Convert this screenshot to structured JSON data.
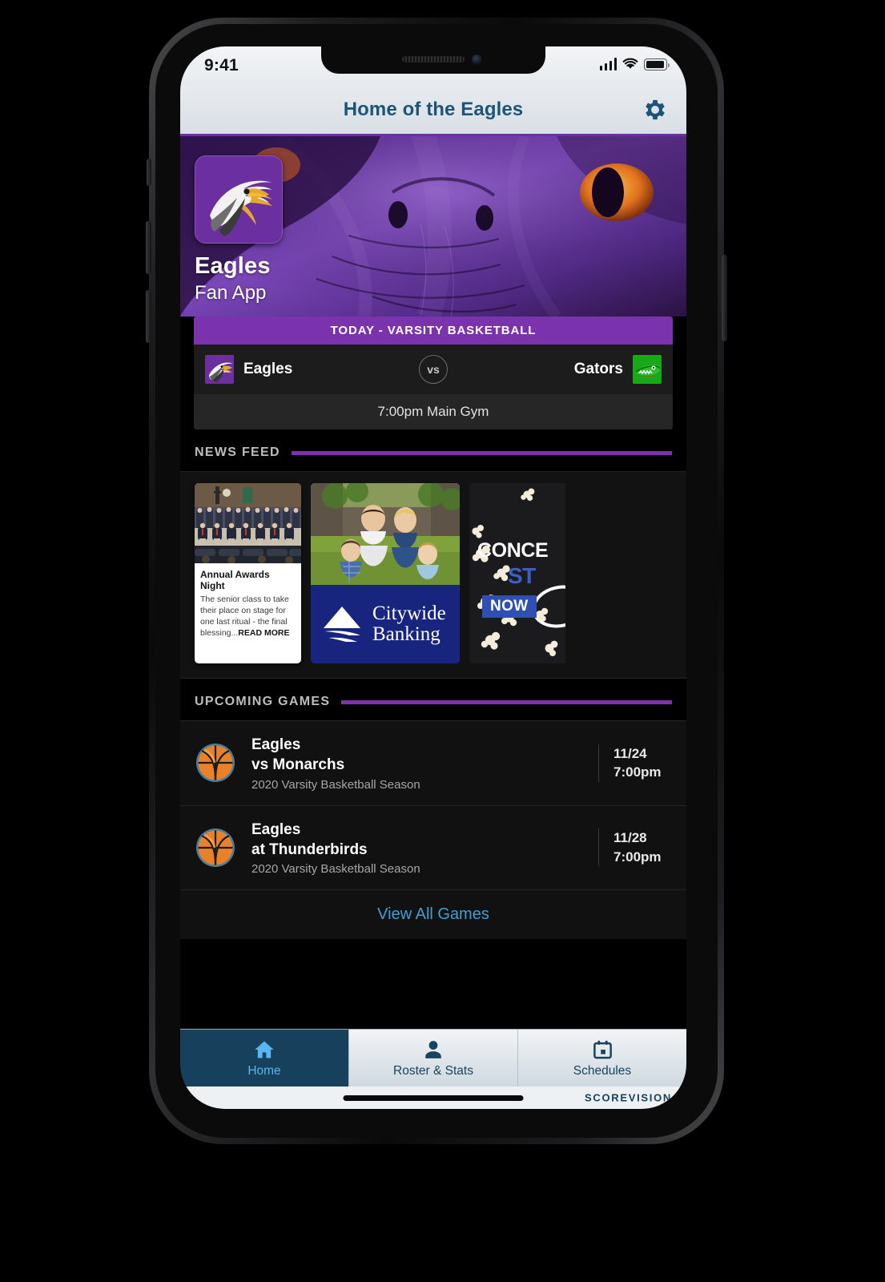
{
  "status_bar": {
    "time": "9:41",
    "signal_icon": "cellular-bars-icon",
    "wifi_icon": "wifi-icon",
    "battery_icon": "battery-icon"
  },
  "nav": {
    "title": "Home of the Eagles",
    "settings_icon": "gear-icon"
  },
  "hero": {
    "team_name": "Eagles",
    "subtitle": "Fan App",
    "logo_icon": "eagle-head-logo",
    "background_icon": "eagle-face-photo"
  },
  "today_game": {
    "header": "TODAY - VARSITY BASKETBALL",
    "home_team": "Eagles",
    "home_logo_icon": "eagles-logo",
    "vs_label": "vs",
    "away_team": "Gators",
    "away_logo_icon": "gators-logo",
    "details": "7:00pm Main Gym"
  },
  "news_section": {
    "title": "NEWS FEED",
    "cards": [
      {
        "type": "article",
        "image_icon": "awards-ceremony-photo",
        "title": "Annual Awards Night",
        "body": "The senior class to take their place on stage for one last ritual - the final blessing...",
        "read_more": "READ MORE"
      },
      {
        "type": "ad",
        "image_icon": "family-on-lawn-photo",
        "brand_line1": "Citywide",
        "brand_line2": "Banking",
        "logo_icon": "citywide-triangle-logo"
      },
      {
        "type": "ad",
        "image_icon": "popcorn-photo",
        "line1": "CONCE",
        "line2": "ST",
        "badge": "NOW"
      }
    ]
  },
  "upcoming_section": {
    "title": "UPCOMING GAMES",
    "games": [
      {
        "icon": "basketball-icon",
        "team": "Eagles",
        "opponent": "vs Monarchs",
        "season": "2020 Varsity Basketball Season",
        "date": "11/24",
        "time": "7:00pm"
      },
      {
        "icon": "basketball-icon",
        "team": "Eagles",
        "opponent": "at Thunderbirds",
        "season": "2020 Varsity Basketball Season",
        "date": "11/28",
        "time": "7:00pm"
      }
    ],
    "view_all_label": "View All Games"
  },
  "tab_bar": {
    "tabs": [
      {
        "label": "Home",
        "icon": "home-icon",
        "active": true
      },
      {
        "label": "Roster & Stats",
        "icon": "person-icon",
        "active": false
      },
      {
        "label": "Schedules",
        "icon": "calendar-icon",
        "active": false
      }
    ]
  },
  "footer": {
    "brand": "SCOREVISION"
  },
  "colors": {
    "accent_purple": "#7b32ad",
    "nav_blue": "#1c5578",
    "link_blue": "#3f9fd6",
    "tab_active_bg": "#16405c",
    "ad_navy": "#17257e"
  }
}
